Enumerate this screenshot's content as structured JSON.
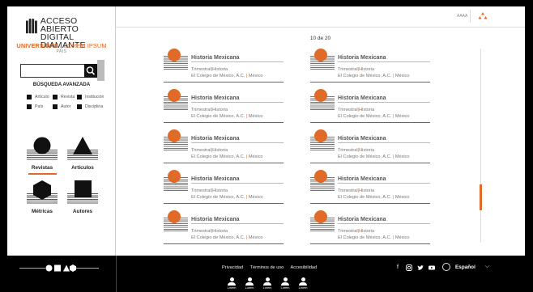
{
  "sidebar": {
    "logo_line1": "ACCESO ABIERTO",
    "logo_line2": "DIGITAL DIAMANTE",
    "university": "UNIVERSIDAD",
    "university_sub": "LOREM IPSUM",
    "country": "PAÍS",
    "search_placeholder": "",
    "advanced_search": "BÚSQUEDA AVANZADA",
    "filters": [
      "Artículo",
      "Revista",
      "Institución",
      "País",
      "Autor",
      "Disciplina"
    ],
    "tiles": [
      {
        "label": "Revistas",
        "icon": "circle-icon",
        "active": true
      },
      {
        "label": "Artículos",
        "icon": "triangle-icon",
        "active": false
      },
      {
        "label": "Métricas",
        "icon": "hexagon-icon",
        "active": false
      },
      {
        "label": "Autores",
        "icon": "square-icon",
        "active": false
      }
    ]
  },
  "topbar": {
    "user": "AAAA"
  },
  "paging": "10 de 20",
  "cards": [
    {
      "title": "Historia Mexicana",
      "freq": "Trimestral",
      "discipline": "Historia",
      "publisher": "El Colegio de México, A.C.",
      "country": "México"
    },
    {
      "title": "Historia Mexicana",
      "freq": "Trimestral",
      "discipline": "Historia",
      "publisher": "El Colegio de México, A.C.",
      "country": "México"
    },
    {
      "title": "Historia Mexicana",
      "freq": "Trimestral",
      "discipline": "Historia",
      "publisher": "El Colegio de México, A.C.",
      "country": "México"
    },
    {
      "title": "Historia Mexicana",
      "freq": "Trimestral",
      "discipline": "Historia",
      "publisher": "El Colegio de México, A.C.",
      "country": "México"
    },
    {
      "title": "Historia Mexicana",
      "freq": "Trimestral",
      "discipline": "Historia",
      "publisher": "El Colegio de México, A.C.",
      "country": "México"
    },
    {
      "title": "Historia Mexicana",
      "freq": "Trimestral",
      "discipline": "Historia",
      "publisher": "El Colegio de México, A.C.",
      "country": "México"
    },
    {
      "title": "Historia Mexicana",
      "freq": "Trimestral",
      "discipline": "Historia",
      "publisher": "El Colegio de México, A.C.",
      "country": "México"
    },
    {
      "title": "Historia Mexicana",
      "freq": "Trimestral",
      "discipline": "Historia",
      "publisher": "El Colegio de México, A.C.",
      "country": "México"
    },
    {
      "title": "Historia Mexicana",
      "freq": "Trimestral",
      "discipline": "Historia",
      "publisher": "El Colegio de México, A.C.",
      "country": "México"
    },
    {
      "title": "Historia Mexicana",
      "freq": "Trimestral",
      "discipline": "Historia",
      "publisher": "El Colegio de México, A.C.",
      "country": "México"
    }
  ],
  "footer": {
    "links": [
      "Privacidad",
      "Términos de uso",
      "Accesibilidad"
    ],
    "social": [
      "facebook-icon",
      "instagram-icon",
      "twitter-icon",
      "youtube-icon"
    ],
    "language": "Español",
    "persons": [
      "Lorem",
      "Lorem",
      "Lorem",
      "Lorem",
      "Lorem"
    ]
  },
  "colors": {
    "accent": "#e06a28",
    "footer_bg": "#000000"
  }
}
